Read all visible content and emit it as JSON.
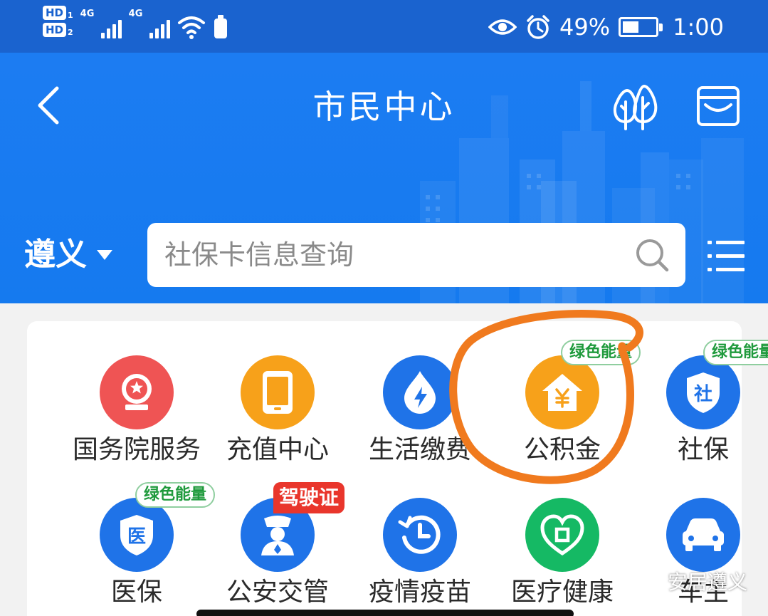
{
  "status_bar": {
    "hd1": "HD",
    "hd1_sub": "1",
    "hd2": "HD",
    "hd2_sub": "2",
    "net1": "4G",
    "net2": "4G",
    "battery_percent": "49%",
    "battery_level": 0.49,
    "time": "1:00",
    "icons": [
      "eye-icon",
      "alarm-icon",
      "wifi-icon",
      "battery-icon"
    ]
  },
  "header": {
    "title": "市民中心",
    "city": "遵义",
    "search_placeholder": "社保卡信息查询",
    "icons": [
      "back-icon",
      "tree-icon",
      "wallet-icon",
      "search-icon",
      "menu-icon"
    ]
  },
  "services": [
    {
      "label": "国务院服务",
      "icon": "emblem-icon",
      "color": "#ef5454",
      "tag": ""
    },
    {
      "label": "充值中心",
      "icon": "phone-icon",
      "color": "#f7a11a",
      "tag": ""
    },
    {
      "label": "生活缴费",
      "icon": "bolt-icon",
      "color": "#1f73e8",
      "tag": ""
    },
    {
      "label": "公积金",
      "icon": "house-yuan-icon",
      "color": "#f7a11a",
      "tag": "绿色能量"
    },
    {
      "label": "社保",
      "icon": "shield-she-icon",
      "color": "#1f73e8",
      "tag": "绿色能量"
    },
    {
      "label": "医保",
      "icon": "shield-yi-icon",
      "color": "#1f73e8",
      "tag": "绿色能量"
    },
    {
      "label": "公安交管",
      "icon": "police-icon",
      "color": "#1f73e8",
      "tag": "驾驶证"
    },
    {
      "label": "疫情疫苗",
      "icon": "clock-history-icon",
      "color": "#1f73e8",
      "tag": ""
    },
    {
      "label": "医疗健康",
      "icon": "heart-cross-icon",
      "color": "#15b964",
      "tag": ""
    },
    {
      "label": "车主",
      "icon": "car-icon",
      "color": "#1f73e8",
      "tag": ""
    }
  ],
  "colors": {
    "status_bar": "#1a63cf",
    "header": "#1c7cf2",
    "annotation": "#f07a1e",
    "green_tag": "#1f9a3c",
    "red_tag": "#e9362c"
  },
  "watermark": "安居遵义"
}
